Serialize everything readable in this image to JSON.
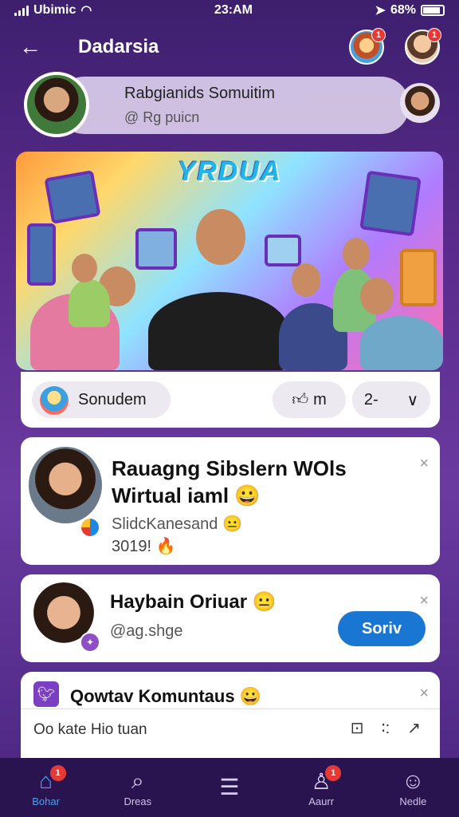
{
  "status_bar": {
    "carrier": "Ubimic",
    "time": "23:AM",
    "battery": "68%"
  },
  "header": {
    "title": "Dadarsia",
    "avatar1_badge": "1",
    "avatar2_badge": "1"
  },
  "profile": {
    "name": "Rabgianids Somuitim",
    "handle": "@ Rg puicn"
  },
  "hero": {
    "title": "YRDUA"
  },
  "action_bar": {
    "chip_label": "Sonudem",
    "like_label": "m",
    "share_label": "2-",
    "more_icon": "chevron-down"
  },
  "card1": {
    "title": "Rauagng Sibslern WOls Wirtual iaml",
    "subtitle": "SlidcKanesand",
    "meta": "3019!"
  },
  "card2": {
    "title": "Haybain Oriuar",
    "handle": "@ag.shge",
    "follow_label": "Soriv"
  },
  "card3": {
    "title": "Qowtav Komuntaus",
    "input_placeholder": "Oo kate Hio tuan"
  },
  "bottom_nav": {
    "items": [
      {
        "label": "Bohar",
        "icon": "home",
        "active": true,
        "badge": "1"
      },
      {
        "label": "Dreas",
        "icon": "search",
        "active": false,
        "badge": ""
      },
      {
        "label": "",
        "icon": "list",
        "active": false,
        "badge": ""
      },
      {
        "label": "Aaurr",
        "icon": "person",
        "active": false,
        "badge": "1"
      },
      {
        "label": "Nedle",
        "icon": "user",
        "active": false,
        "badge": ""
      }
    ]
  },
  "colors": {
    "accent": "#1976d2",
    "active_nav": "#4aa3f0",
    "background": "#5a2b8c"
  }
}
